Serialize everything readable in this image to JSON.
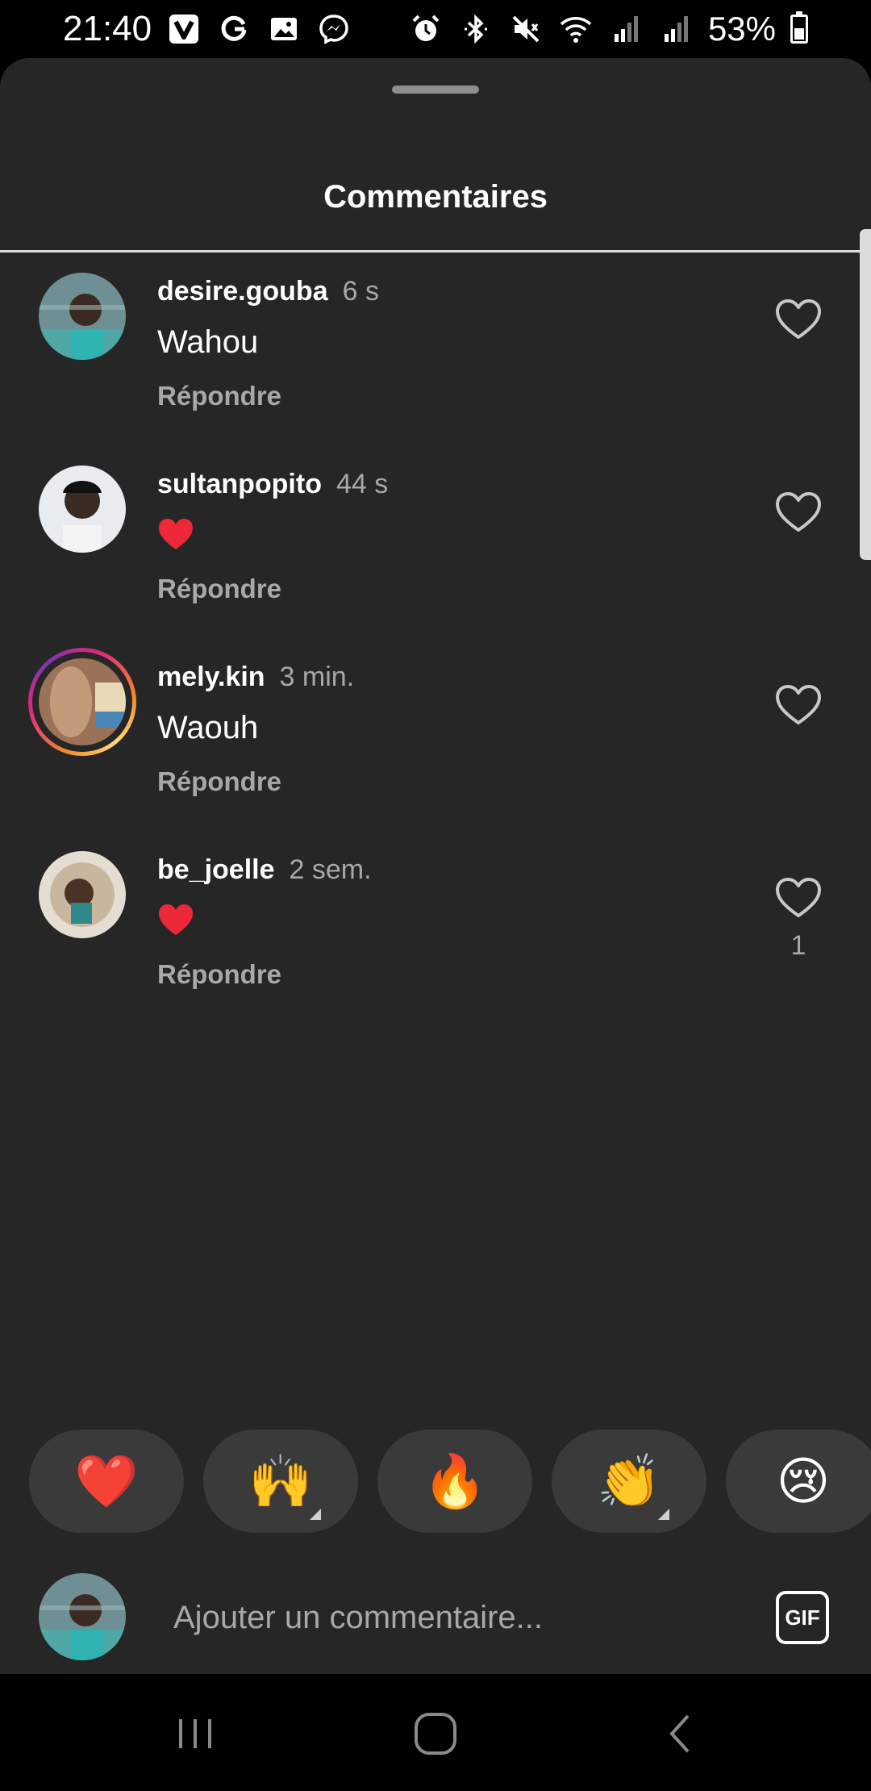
{
  "status_bar": {
    "time": "21:40",
    "battery": "53%",
    "battery_level": 0.53,
    "left_icons": [
      "v-app-icon",
      "google-icon",
      "gallery-icon",
      "messenger-icon"
    ],
    "right_icons": [
      "alarm-icon",
      "bluetooth-icon",
      "mute-icon",
      "wifi-icon",
      "signal-icon",
      "signal-icon"
    ]
  },
  "sheet": {
    "title": "Commentaires"
  },
  "comments": [
    {
      "username": "desire.gouba",
      "time": "6 s",
      "text": "Wahou",
      "reply_label": "Répondre",
      "likes": "",
      "has_story": false,
      "emoji_heart": false
    },
    {
      "username": "sultanpopito",
      "time": "44 s",
      "text": "",
      "reply_label": "Répondre",
      "likes": "",
      "has_story": false,
      "emoji_heart": true
    },
    {
      "username": "mely.kin",
      "time": "3 min.",
      "text": "Waouh",
      "reply_label": "Répondre",
      "likes": "",
      "has_story": true,
      "emoji_heart": false
    },
    {
      "username": "be_joelle",
      "time": "2 sem.",
      "text": "",
      "reply_label": "Répondre",
      "likes": "1",
      "has_story": false,
      "emoji_heart": true
    }
  ],
  "reactions": [
    {
      "emoji": "❤️",
      "name": "red-heart"
    },
    {
      "emoji": "🙌",
      "name": "raising-hands",
      "has_more": true
    },
    {
      "emoji": "🔥",
      "name": "fire"
    },
    {
      "emoji": "👏",
      "name": "clapping-hands",
      "has_more": true
    },
    {
      "emoji": "😢",
      "name": "crying-face"
    }
  ],
  "composer": {
    "placeholder": "Ajouter un commentaire...",
    "gif_label": "GIF"
  },
  "colors": {
    "background": "#262626",
    "secondary_text": "#a8a8a8",
    "heart_red": "#ed2939",
    "chip": "#3a3a3a"
  }
}
